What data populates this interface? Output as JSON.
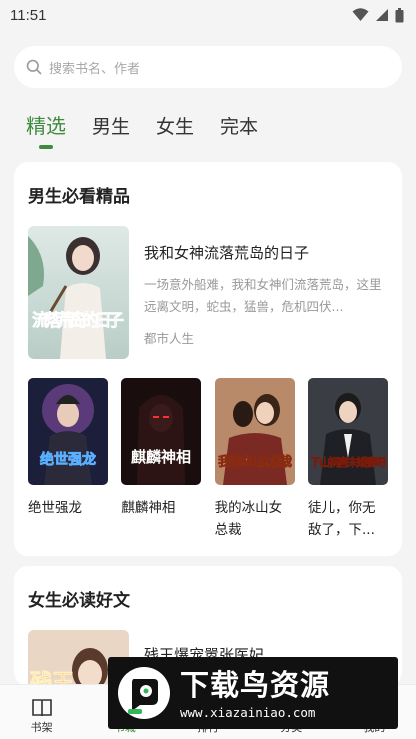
{
  "status": {
    "time": "11:51"
  },
  "search": {
    "placeholder": "搜索书名、作者"
  },
  "tabs": [
    {
      "label": "精选",
      "active": true
    },
    {
      "label": "男生"
    },
    {
      "label": "女生"
    },
    {
      "label": "完本"
    }
  ],
  "male_section": {
    "title": "男生必看精品",
    "featured": {
      "title": "我和女神流落荒岛的日子",
      "description": "一场意外船难，我和女神们流落荒岛，这里远离文明，蛇虫，猛兽，危机四伏...",
      "category": "都市人生",
      "cover_text": "流落荒岛的日子"
    },
    "books": [
      {
        "title": "绝世强龙",
        "cover_text": "绝世强龙"
      },
      {
        "title": "麒麟神相",
        "cover_text": "麒麟神相"
      },
      {
        "title": "我的冰山女总裁",
        "cover_text": "我的冰山女总裁"
      },
      {
        "title": "徒儿，你无敌了，下...",
        "cover_text": "下山祸害未婚妻吧"
      }
    ]
  },
  "female_section": {
    "title": "女生必读好文",
    "featured": {
      "title": "残王爆宠嚣张医妃",
      "cover_text": "残王"
    }
  },
  "bottom_nav": [
    {
      "label": "书架",
      "icon": "book-open-icon"
    },
    {
      "label": "书城",
      "icon": "store-icon",
      "active": true
    },
    {
      "label": "排行",
      "icon": "rank-icon"
    },
    {
      "label": "分类",
      "icon": "category-icon"
    },
    {
      "label": "我的",
      "icon": "user-icon"
    }
  ],
  "watermark": {
    "name": "下载鸟资源",
    "url": "www.xiazainiao.com"
  },
  "colors": {
    "accent": "#3f8a3f",
    "background": "#f4f4f4",
    "card": "#ffffff"
  }
}
